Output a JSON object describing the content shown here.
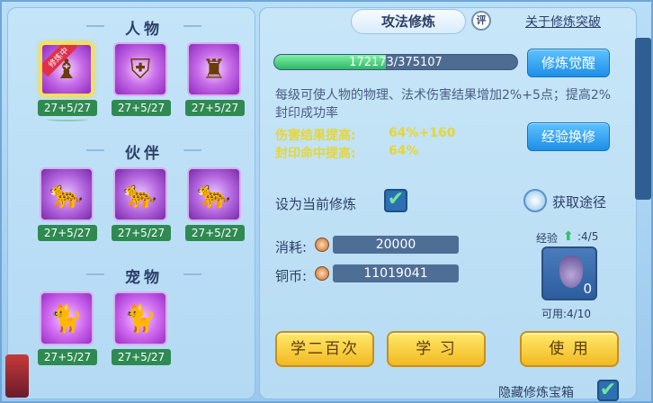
{
  "left": {
    "sections": [
      {
        "title": "人物",
        "skills": [
          {
            "level": "27+5/27",
            "badge": "修炼中",
            "selected": true,
            "icon": "bell-icon"
          },
          {
            "level": "27+5/27",
            "icon": "armor-icon"
          },
          {
            "level": "27+5/27",
            "icon": "warrior-icon"
          }
        ]
      },
      {
        "title": "伙伴",
        "skills": [
          {
            "level": "27+5/27",
            "icon": "beast-sword-icon"
          },
          {
            "level": "27+5/27",
            "icon": "beast-shield-icon"
          },
          {
            "level": "27+5/27",
            "icon": "beast-claw-icon"
          }
        ]
      },
      {
        "title": "宠物",
        "skills": [
          {
            "level": "27+5/27",
            "icon": "pet-sword-icon"
          },
          {
            "level": "27+5/27",
            "icon": "pet-shield-icon"
          }
        ]
      }
    ]
  },
  "header": {
    "tab_label": "攻法修炼",
    "rate_label": "评",
    "link_label": "关于修炼突破"
  },
  "progress": {
    "text": "172173/375107",
    "fraction": 0.459
  },
  "buttons": {
    "awaken": "修炼觉醒",
    "exchange": "经验换修",
    "learn200": "学二百次",
    "learn": "学 习",
    "use": "使 用"
  },
  "description": "每级可使人物的物理、法术伤害结果增加2%+5点；提高2%封印成功率",
  "stats": [
    {
      "label": "伤害结果提高:",
      "value": "64%+160"
    },
    {
      "label": "封印命中提高:",
      "value": "64%"
    }
  ],
  "current": {
    "label": "设为当前修炼",
    "checked": true
  },
  "obtain": {
    "label": "获取途径"
  },
  "cost": {
    "consume_label": "消耗:",
    "consume_value": "20000",
    "copper_label": "铜币:",
    "copper_value": "11019041"
  },
  "item": {
    "exp_label": "经验",
    "exp_value": ":4/5",
    "count": "0",
    "available": "可用:4/10"
  },
  "hide_chest": {
    "label": "隐藏修炼宝箱",
    "checked": true
  },
  "colors": {
    "accent_blue": "#1e8ee6",
    "accent_yellow": "#f2b923",
    "stat_yellow": "#e6d636",
    "progress_green": "#2fb866"
  }
}
